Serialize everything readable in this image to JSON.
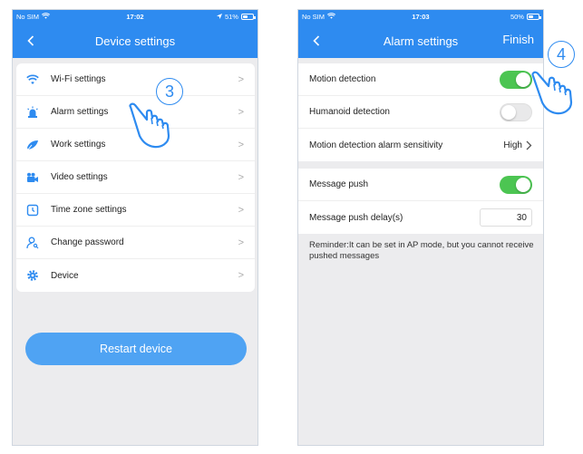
{
  "screen1": {
    "status": {
      "carrier": "No SIM",
      "time": "17:02",
      "battery": "51%",
      "battery_level": 0.51
    },
    "nav": {
      "back": "<",
      "title": "Device settings"
    },
    "menu": [
      {
        "label": "Wi-Fi settings",
        "icon": "wifi-icon"
      },
      {
        "label": "Alarm settings",
        "icon": "alarm-light-icon"
      },
      {
        "label": "Work settings",
        "icon": "work-icon"
      },
      {
        "label": "Video settings",
        "icon": "video-camera-icon"
      },
      {
        "label": "Time zone settings",
        "icon": "clock-icon"
      },
      {
        "label": "Change password",
        "icon": "user-key-icon"
      },
      {
        "label": "Device",
        "icon": "gear-icon"
      }
    ],
    "chevron": ">",
    "restart_label": "Restart device",
    "step_label": "3"
  },
  "screen2": {
    "status": {
      "carrier": "No SIM",
      "time": "17:03",
      "battery": "50%",
      "battery_level": 0.5
    },
    "nav": {
      "back": "<",
      "title": "Alarm settings",
      "finish": "Finish"
    },
    "group1": {
      "motion_detection": {
        "label": "Motion detection",
        "on": true
      },
      "humanoid_detection": {
        "label": "Humanoid detection",
        "on": false
      },
      "sensitivity": {
        "label": "Motion detection alarm sensitivity",
        "value": "High"
      }
    },
    "group2": {
      "message_push": {
        "label": "Message push",
        "on": true
      },
      "push_delay": {
        "label": "Message push delay(s)",
        "value": "30"
      }
    },
    "reminder": "Reminder:It can be set in AP mode, but you cannot receive pushed messages",
    "step_label": "4"
  },
  "colors": {
    "accent": "#2e8bf0",
    "toggle_on": "#4cc552",
    "button": "#4fa3f3",
    "background": "#ececee"
  }
}
